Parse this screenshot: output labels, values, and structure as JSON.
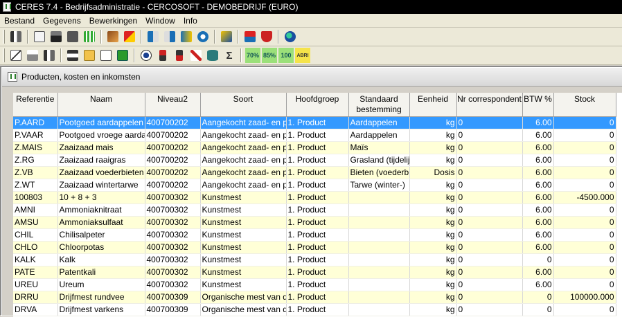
{
  "window": {
    "title": "CERES 7.4 - Bedrijfsadministratie - CERCOSOFT - DEMOBEDRIJF (EURO)"
  },
  "menu": [
    "Bestand",
    "Gegevens",
    "Bewerkingen",
    "Window",
    "Info"
  ],
  "toolbar1": [
    "exit-icon",
    "card-icon",
    "truck-icon",
    "building-icon",
    "grid-icon",
    "tools-icon",
    "lightning-icon",
    "import-icon",
    "export-icon",
    "swap-icon",
    "refresh-icon",
    "handshake-icon",
    "network-icon",
    "shield-icon",
    "globe-icon"
  ],
  "toolbar2": [
    "edit-icon",
    "print-icon",
    "exit-icon",
    "save-icon",
    "open-icon",
    "new-icon",
    "delete-icon",
    "view-icon",
    "sort-asc-icon",
    "sort-desc-icon",
    "cut-icon",
    "database-icon",
    "sum-icon"
  ],
  "toolbar2_text": {
    "pct70": "70%",
    "pct85": "85%",
    "pct100": "100",
    "abri": "ABRI"
  },
  "child_window": {
    "title": "Producten, kosten en inkomsten"
  },
  "columns": [
    "Referentie",
    "Naam",
    "Niveau2",
    "Soort",
    "Hoofdgroep",
    "Standaard bestemming",
    "Eenheid",
    "Nr correspondent",
    "BTW %",
    "Stock"
  ],
  "rows": [
    [
      "P.AARD",
      "Pootgoed aardappelen",
      "400700202",
      "Aangekocht zaad- en pootgoed",
      "1. Product",
      "Aardappelen",
      "kg",
      "0",
      "6.00",
      "0"
    ],
    [
      "P.VAAR",
      "Pootgoed vroege aardappelen",
      "400700202",
      "Aangekocht zaad- en pootgoed",
      "1. Product",
      "Aardappelen",
      "kg",
      "0",
      "6.00",
      "0"
    ],
    [
      "Z.MAIS",
      "Zaaizaad mais",
      "400700202",
      "Aangekocht zaad- en pootgoed",
      "1. Product",
      "Maïs",
      "kg",
      "0",
      "6.00",
      "0"
    ],
    [
      "Z.RG",
      "Zaaizaad raaigras",
      "400700202",
      "Aangekocht zaad- en pootgoed",
      "1. Product",
      "Grasland (tijdelijk)",
      "kg",
      "0",
      "6.00",
      "0"
    ],
    [
      "Z.VB",
      "Zaaizaad voederbieten",
      "400700202",
      "Aangekocht zaad- en pootgoed",
      "1. Product",
      "Bieten (voederbieten)",
      "Dosis",
      "0",
      "6.00",
      "0"
    ],
    [
      "Z.WT",
      "Zaaizaad wintertarwe",
      "400700202",
      "Aangekocht zaad- en pootgoed",
      "1. Product",
      "Tarwe (winter-)",
      "kg",
      "0",
      "6.00",
      "0"
    ],
    [
      "100803",
      "10 + 8 + 3",
      "400700302",
      "Kunstmest",
      "1. Product",
      "",
      "kg",
      "0",
      "6.00",
      "-4500.000"
    ],
    [
      "AMNI",
      "Ammoniaknitraat",
      "400700302",
      "Kunstmest",
      "1. Product",
      "",
      "kg",
      "0",
      "6.00",
      "0"
    ],
    [
      "AMSU",
      "Ammoniaksulfaat",
      "400700302",
      "Kunstmest",
      "1. Product",
      "",
      "kg",
      "0",
      "6.00",
      "0"
    ],
    [
      "CHIL",
      "Chilisalpeter",
      "400700302",
      "Kunstmest",
      "1. Product",
      "",
      "kg",
      "0",
      "6.00",
      "0"
    ],
    [
      "CHLO",
      "Chloorpotas",
      "400700302",
      "Kunstmest",
      "1. Product",
      "",
      "kg",
      "0",
      "6.00",
      "0"
    ],
    [
      "KALK",
      "Kalk",
      "400700302",
      "Kunstmest",
      "1. Product",
      "",
      "kg",
      "0",
      "0",
      "0"
    ],
    [
      "PATE",
      "Patentkali",
      "400700302",
      "Kunstmest",
      "1. Product",
      "",
      "kg",
      "0",
      "6.00",
      "0"
    ],
    [
      "UREU",
      "Ureum",
      "400700302",
      "Kunstmest",
      "1. Product",
      "",
      "kg",
      "0",
      "6.00",
      "0"
    ],
    [
      "DRRU",
      "Drijfmest rundvee",
      "400700309",
      "Organische mest van derden",
      "1. Product",
      "",
      "kg",
      "0",
      "0",
      "100000.000"
    ],
    [
      "DRVA",
      "Drijfmest varkens",
      "400700309",
      "Organische mest van derden",
      "1. Product",
      "",
      "kg",
      "0",
      "0",
      "0"
    ]
  ],
  "selected_row": 0,
  "colors": {
    "selection": "#3399ff",
    "row_alt": "#ffffd7",
    "titlebar": "#000000"
  }
}
